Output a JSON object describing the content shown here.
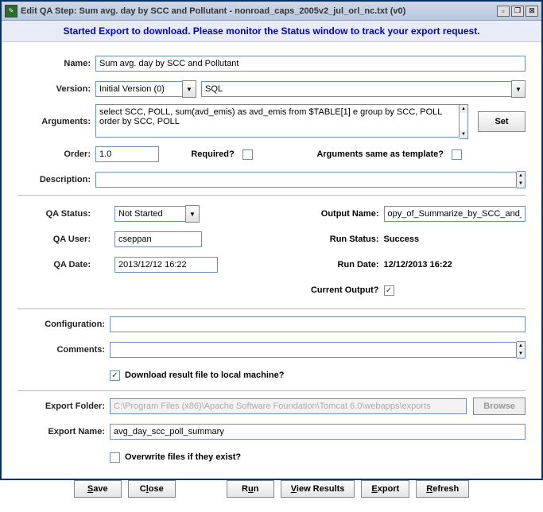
{
  "title": "Edit QA Step: Sum avg. day by SCC and Pollutant - nonroad_caps_2005v2_jul_orl_nc.txt (v0)",
  "banner": "Started Export to download. Please monitor the Status window to track your export request.",
  "labels": {
    "name": "Name:",
    "version": "Version:",
    "arguments": "Arguments:",
    "order": "Order:",
    "required": "Required?",
    "args_same": "Arguments same as template?",
    "description": "Description:",
    "qa_status": "QA Status:",
    "qa_user": "QA User:",
    "qa_date": "QA Date:",
    "output_name": "Output Name:",
    "run_status": "Run Status:",
    "run_date": "Run Date:",
    "current_output": "Current Output?",
    "configuration": "Configuration:",
    "comments": "Comments:",
    "download": "Download result file to local machine?",
    "export_folder": "Export Folder:",
    "export_name": "Export Name:",
    "overwrite": "Overwrite files if they exist?"
  },
  "fields": {
    "name": "Sum avg. day by SCC and Pollutant",
    "version": "Initial Version (0)",
    "program": "SQL",
    "arguments": "select SCC, POLL, sum(avd_emis) as avd_emis from $TABLE[1] e group by SCC, POLL order by SCC, POLL",
    "order": "1.0",
    "required": false,
    "args_same": false,
    "description": "",
    "qa_status": "Not Started",
    "qa_user": "cseppan",
    "qa_date": "2013/12/12 16:22",
    "output_name": "opy_of_Summarize_by_SCC_and_Pollu",
    "run_status": "Success",
    "run_date": "12/12/2013 16:22",
    "current_output": true,
    "configuration": "",
    "comments": "",
    "download": true,
    "export_folder": "C:\\Program Files (x86)\\Apache Software Foundation\\Tomcat 6.0\\webapps\\exports",
    "export_name": "avg_day_scc_poll_summary",
    "overwrite": false
  },
  "buttons": {
    "set": "Set",
    "browse": "Browse",
    "save": "Save",
    "close": "Close",
    "run": "Run",
    "view_results": "View Results",
    "export": "Export",
    "refresh": "Refresh"
  }
}
